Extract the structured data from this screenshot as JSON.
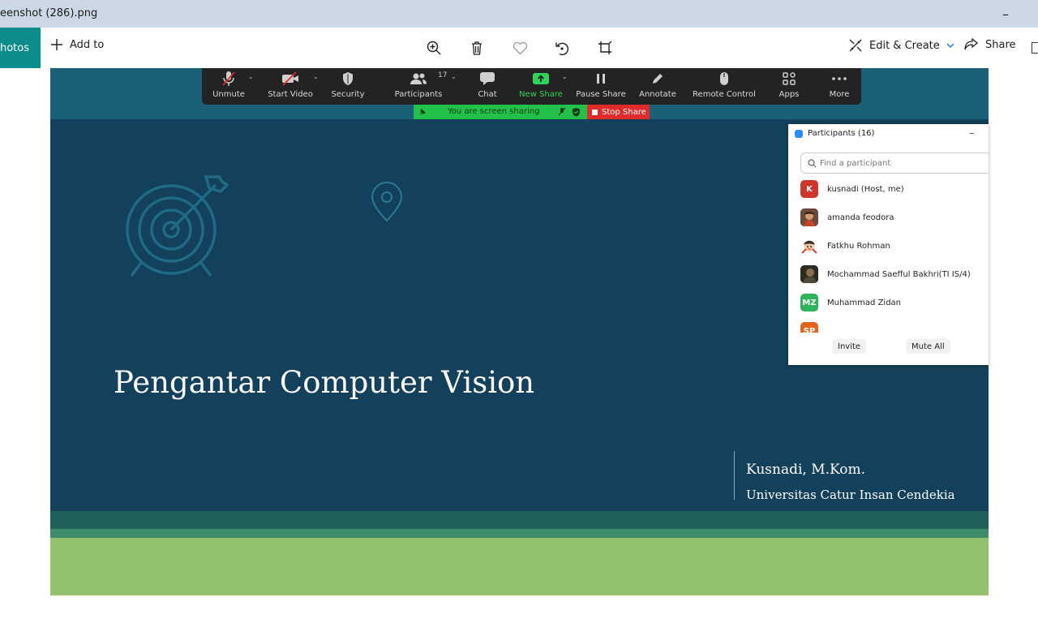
{
  "window": {
    "title": "eenshot (286).png",
    "minimize_glyph": "–"
  },
  "appbar": {
    "photos_label": "Photos",
    "add_to_label": "Add to",
    "tools": [
      {
        "name": "zoom-in-icon"
      },
      {
        "name": "delete-icon"
      },
      {
        "name": "favorite-icon"
      },
      {
        "name": "rotate-icon"
      },
      {
        "name": "crop-icon"
      }
    ],
    "edit_create_label": "Edit & Create",
    "share_label": "Share"
  },
  "slide": {
    "title": "Pengantar Computer Vision",
    "author": "Kusnadi, M.Kom.",
    "university": "Universitas Catur Insan Cendekia"
  },
  "zoom_toolbar": {
    "unmute": "Unmute",
    "start_video": "Start Video",
    "security": "Security",
    "participants": "Participants",
    "participants_count": "17",
    "chat": "Chat",
    "new_share": "New Share",
    "pause_share": "Pause Share",
    "annotate": "Annotate",
    "remote_control": "Remote Control",
    "apps": "Apps",
    "more": "More"
  },
  "share_banner": {
    "text": "You are screen sharing",
    "stop_label": "Stop Share"
  },
  "participants_panel": {
    "title": "Participants (16)",
    "search_placeholder": "Find a participant",
    "participants": [
      {
        "name": "kusnadi (Host, me)",
        "initials": "K",
        "color": "#d0352b"
      },
      {
        "name": "amanda feodora",
        "initials": "",
        "color": "#b46a4f"
      },
      {
        "name": "Fatkhu Rohman",
        "initials": "",
        "color": "#f2c9a2"
      },
      {
        "name": "Mochammad Saefful Bakhri(TI IS/4)",
        "initials": "",
        "color": "#3b3a2a"
      },
      {
        "name": "Muhammad Zidan",
        "initials": "MZ",
        "color": "#2fb35a"
      },
      {
        "name": "",
        "initials": "SP",
        "color": "#e0661f"
      }
    ],
    "invite_label": "Invite",
    "mute_all_label": "Mute All"
  }
}
